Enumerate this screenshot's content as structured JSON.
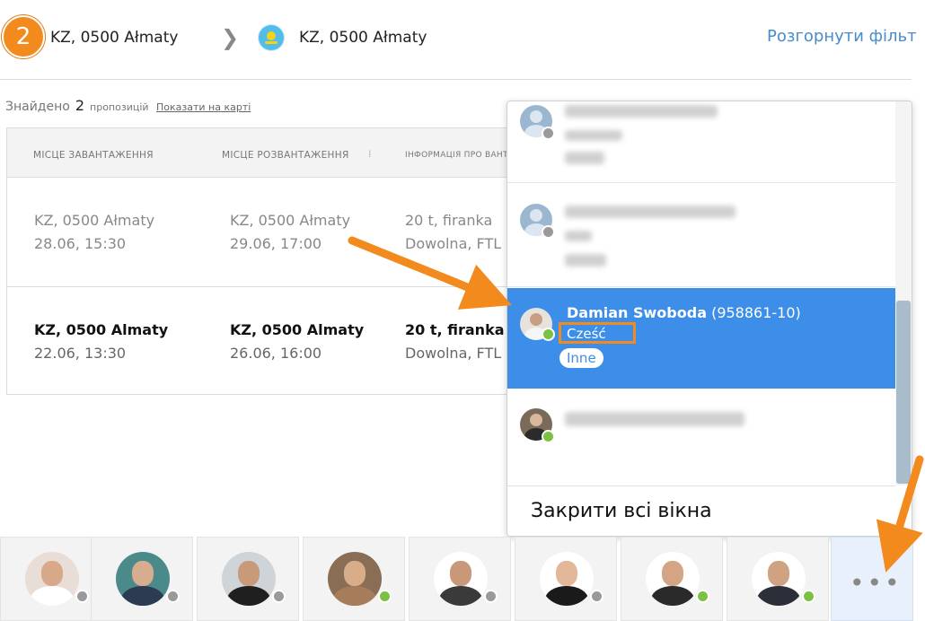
{
  "route": {
    "step_number": "2",
    "from": "KZ, 0500 Ałmaty",
    "to": "KZ, 0500 Ałmaty",
    "expand_filter_label": "Розгорнути фільт"
  },
  "results": {
    "found_label": "Знайдено",
    "count": "2",
    "offers_label": "пропозицій",
    "show_on_map": "Показати на карті"
  },
  "table": {
    "headers": [
      "МІСЦЕ ЗАВАНТАЖЕННЯ",
      "МІСЦЕ РОЗВАНТАЖЕННЯ",
      "ІНФОРМАЦІЯ ПРО ВАНТ"
    ],
    "sort_indicator": "⁞",
    "rows": [
      {
        "loading_place": "KZ, 0500 Ałmaty",
        "loading_date": "28.06, 15:30",
        "unloading_place": "KZ, 0500 Ałmaty",
        "unloading_date": "29.06, 17:00",
        "cargo": "20 t, firanka",
        "cargo_type": "Dowolna, FTL"
      },
      {
        "loading_place": "KZ, 0500 Almaty",
        "loading_date": "22.06, 13:30",
        "unloading_place": "KZ, 0500 Almaty",
        "unloading_date": "26.06, 16:00",
        "cargo": "20 t, firanka",
        "cargo_type": "Dowolna, FTL"
      }
    ]
  },
  "chat": {
    "active": {
      "name": "Damian Swoboda",
      "id": "(958861-10)",
      "message": "Cześć",
      "tag": "Inne"
    },
    "close_all_label": "Закрити всі вікна"
  },
  "bottom_bar": {
    "avatars": [
      {
        "status": "offline",
        "status_color": "#9a9a9a"
      },
      {
        "status": "offline",
        "status_color": "#9a9a9a"
      },
      {
        "status": "offline",
        "status_color": "#9a9a9a"
      },
      {
        "status": "online",
        "status_color": "#7cc242"
      },
      {
        "status": "offline",
        "status_color": "#9a9a9a"
      },
      {
        "status": "offline",
        "status_color": "#9a9a9a"
      },
      {
        "status": "online",
        "status_color": "#7cc242"
      },
      {
        "status": "online",
        "status_color": "#7cc242"
      }
    ],
    "more_label": "•••"
  },
  "colors": {
    "accent_orange": "#f28a1e",
    "chat_active_blue": "#3d8ee8",
    "link_blue": "#4a8cc9",
    "online_green": "#7cc242",
    "offline_gray": "#9a9a9a"
  }
}
